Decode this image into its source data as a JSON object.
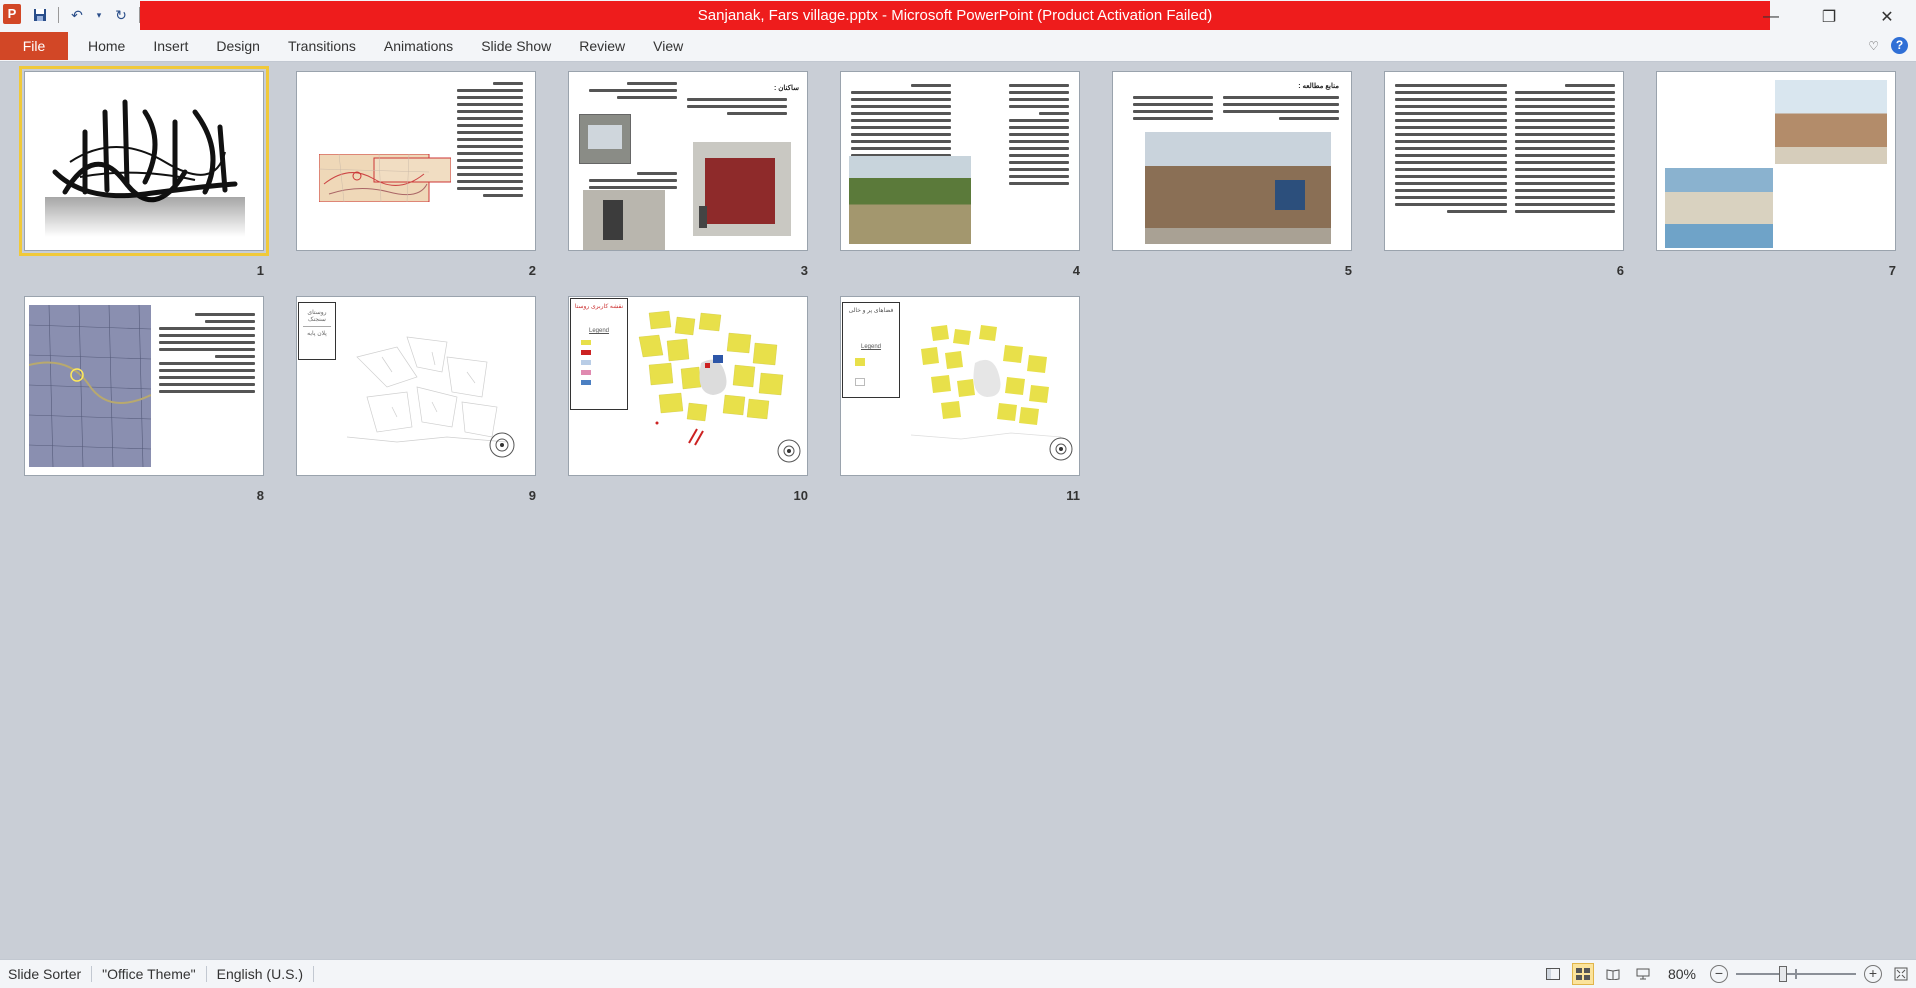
{
  "app": {
    "logo_letter": "P",
    "title": "Sanjanak, Fars village.pptx  -  Microsoft PowerPoint (Product Activation Failed)"
  },
  "ribbon": {
    "file_label": "File",
    "tabs": [
      "Home",
      "Insert",
      "Design",
      "Transitions",
      "Animations",
      "Slide Show",
      "Review",
      "View"
    ]
  },
  "slides": [
    {
      "number": "1",
      "selected": true
    },
    {
      "number": "2"
    },
    {
      "number": "3",
      "heading": "ساکنان :"
    },
    {
      "number": "4"
    },
    {
      "number": "5",
      "heading": "منابع مطالعه :"
    },
    {
      "number": "6"
    },
    {
      "number": "7"
    },
    {
      "number": "8"
    },
    {
      "number": "9",
      "legend_title": "روستای سنجنک",
      "legend_sub": "پلان پایه"
    },
    {
      "number": "10",
      "legend_title": "نقشه کاربری روستا",
      "legend_sub": "Legend"
    },
    {
      "number": "11",
      "legend_title": "فضاهای پر و خالی",
      "legend_sub": "Legend"
    }
  ],
  "statusbar": {
    "view": "Slide Sorter",
    "theme": "\"Office Theme\"",
    "language": "English (U.S.)",
    "zoom": "80%",
    "zoom_level": 0.8
  },
  "colors": {
    "title_bar_red": "#ee1c1c",
    "file_tab": "#d24726",
    "selection": "#f0c93a",
    "yellow_parcel": "#e8e04a"
  }
}
